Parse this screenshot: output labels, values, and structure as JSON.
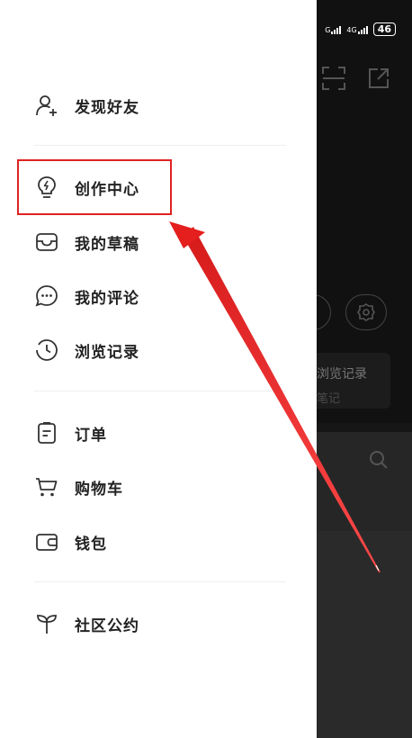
{
  "status_bar": {
    "signal1_label": "G",
    "signal2_label": "4G",
    "battery": "46"
  },
  "menu": {
    "find_friends": "发现好友",
    "creator_center": "创作中心",
    "my_drafts": "我的草稿",
    "my_comments": "我的评论",
    "history": "浏览记录",
    "orders": "订单",
    "cart": "购物车",
    "wallet": "钱包",
    "community_rules": "社区公约"
  },
  "background": {
    "text1": "浏览记录",
    "text2": "笔记"
  },
  "annotation": {
    "highlight_color": "#e02222"
  }
}
